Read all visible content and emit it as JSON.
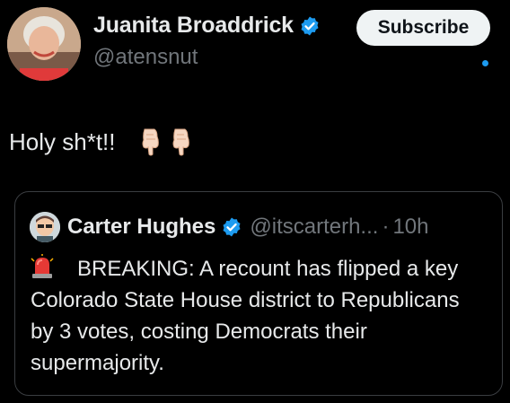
{
  "author": {
    "display_name": "Juanita Broaddrick",
    "handle": "@atensnut",
    "avatar_icon": "profile-photo"
  },
  "subscribe_label": "Subscribe",
  "tweet": {
    "text": "Holy sh*t!!",
    "emoji_icons": [
      "backhand-index-pointing-down-icon",
      "backhand-index-pointing-down-icon"
    ]
  },
  "quoted_tweet": {
    "display_name": "Carter Hughes",
    "handle": "@itscarterh...",
    "separator": "·",
    "time": "10h",
    "body": "BREAKING: A recount has flipped a key Colorado State House district to Republicans by 3 votes, costing Democrats their supermajority.",
    "emoji_icon": "police-light-icon"
  },
  "colors": {
    "background": "#000000",
    "text": "#e7e9ea",
    "muted": "#71767b",
    "accent": "#1d9bf0",
    "border": "#3a3d41"
  }
}
